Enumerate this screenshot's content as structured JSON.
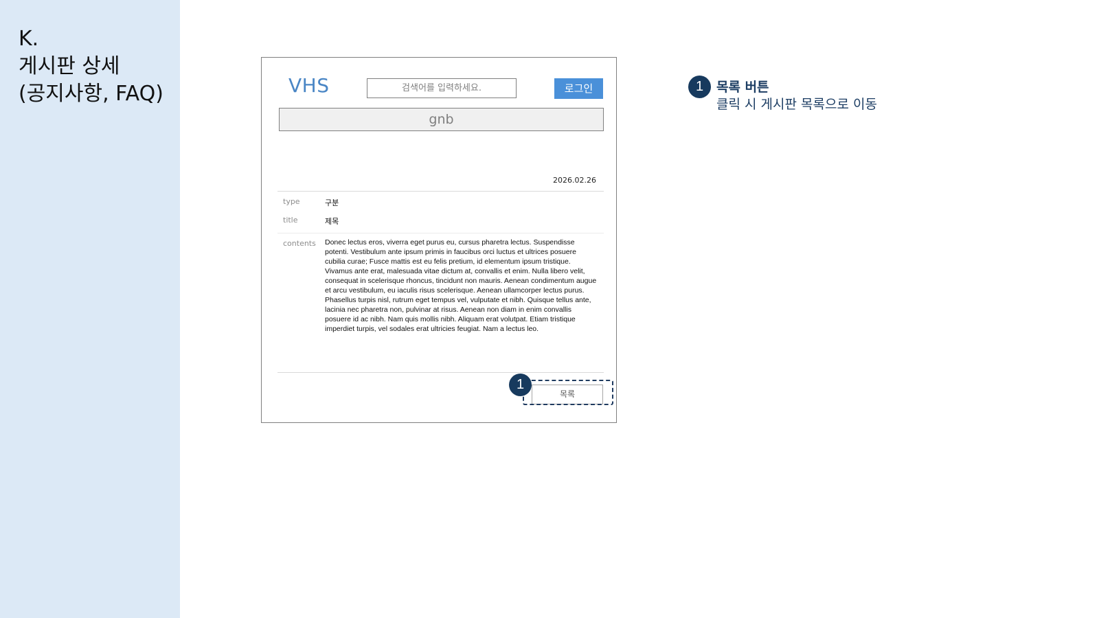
{
  "section": {
    "title_lines": [
      "K.",
      "게시판 상세",
      "(공지사항, FAQ)"
    ]
  },
  "header": {
    "logo": "VHS",
    "search_placeholder": "검색어를 입력하세요.",
    "login_label": "로그인",
    "gnb_label": "gnb"
  },
  "post": {
    "date": "2026.02.26",
    "type_label": "type",
    "type_value": "구분",
    "title_label": "title",
    "title_value": "제목",
    "contents_label": "contents",
    "contents_value": "Donec lectus eros, viverra eget purus eu, cursus pharetra lectus. Suspendisse potenti. Vestibulum ante ipsum primis in faucibus orci luctus et ultrices posuere cubilia curae; Fusce mattis est eu felis pretium, id elementum ipsum tristique. Vivamus ante erat, malesuada vitae dictum at, convallis et enim. Nulla libero velit, consequat in scelerisque rhoncus, tincidunt non mauris. Aenean condimentum augue et arcu vestibulum, eu iaculis risus scelerisque. Aenean ullamcorper lectus purus. Phasellus turpis nisl, rutrum eget tempus vel, vulputate et nibh. Quisque tellus ante, lacinia nec pharetra non, pulvinar at risus. Aenean non diam in enim convallis posuere id ac nibh. Nam quis mollis nibh. Aliquam erat volutpat. Etiam tristique imperdiet turpis, vel sodales erat ultricies feugiat. Nam a lectus leo.",
    "list_button": "목록"
  },
  "annotations": [
    {
      "number": "1",
      "title": "목록 버튼",
      "description": "클릭 시 게시판 목록으로 이동"
    }
  ],
  "colors": {
    "side_panel": "#dce9f6",
    "logo": "#4a86c5",
    "login_button": "#4a90d9",
    "marker": "#173a5e",
    "annotation_text": "#1c3d63"
  }
}
